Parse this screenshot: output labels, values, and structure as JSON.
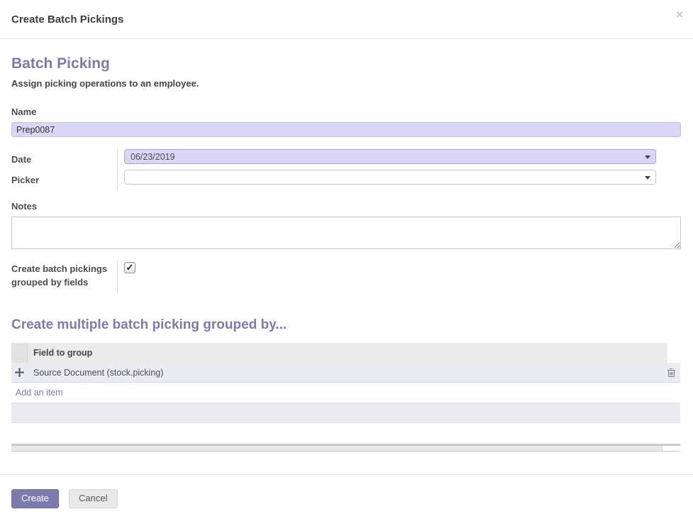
{
  "modal": {
    "title": "Create Batch Pickings",
    "close_glyph": "×"
  },
  "form": {
    "heading": "Batch Picking",
    "subheading": "Assign picking operations to an employee.",
    "name": {
      "label": "Name",
      "value": "Prep0087"
    },
    "date": {
      "label": "Date",
      "value": "06/23/2019"
    },
    "picker": {
      "label": "Picker",
      "value": ""
    },
    "notes": {
      "label": "Notes",
      "value": ""
    },
    "group_checkbox": {
      "label": "Create batch pickings grouped by fields",
      "checked": true,
      "check_glyph": "✓"
    }
  },
  "group_section": {
    "heading": "Create multiple batch picking grouped by...",
    "table": {
      "header": "Field to group",
      "rows": [
        {
          "field": "Source Document (stock.picking)"
        }
      ],
      "add_link_label": "Add an item"
    }
  },
  "footer": {
    "create_label": "Create",
    "cancel_label": "Cancel"
  },
  "colors": {
    "accent": "#7c7bad",
    "field_highlight": "#d8d8f6",
    "row_highlight": "#ebebf4"
  }
}
